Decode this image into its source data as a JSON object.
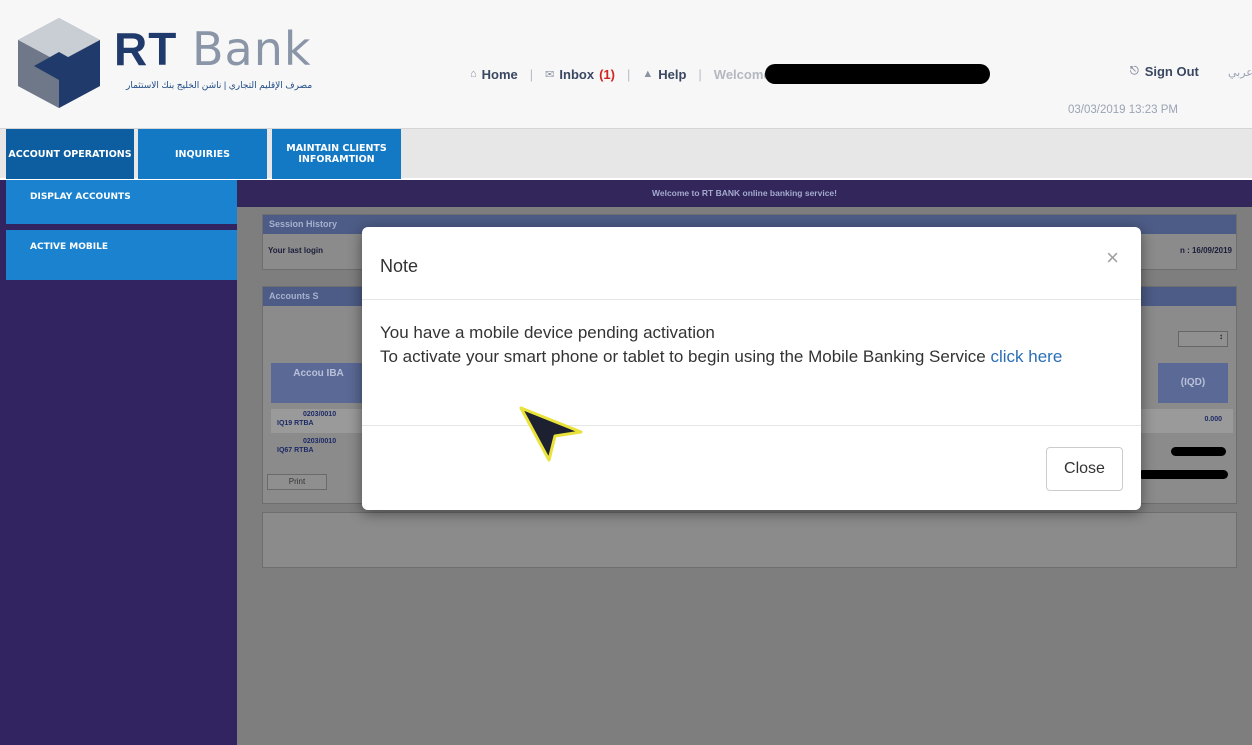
{
  "header": {
    "logo_rt": "RT",
    "logo_bank": "Bank",
    "logo_subtitle": "مصرف الإقليم التجاري | ناشن الخليج بنك الاستثمار",
    "nav": {
      "home": "Home",
      "inbox": "Inbox",
      "inbox_count": "(1)",
      "help": "Help",
      "welcome": "Welcome"
    },
    "sign_out": "Sign Out",
    "language": "عربي",
    "datetime": "03/03/2019 13:23 PM"
  },
  "tabs": [
    {
      "label": "ACCOUNT OPERATIONS"
    },
    {
      "label": "INQUIRIES"
    },
    {
      "label": "MAINTAIN CLIENTS INFORAMTION"
    }
  ],
  "sidebar": {
    "items": [
      {
        "label": "DISPLAY ACCOUNTS"
      },
      {
        "label": "ACTIVE MOBILE"
      }
    ]
  },
  "main": {
    "welcome_banner": "Welcome to RT BANK online banking service!",
    "session_history": {
      "title": "Session History",
      "last_login_label": "Your last login",
      "right_value": "n : 16/09/2019"
    },
    "accounts": {
      "title": "Accounts S",
      "col_account": "Accou IBA",
      "col_balance": "(IQD)",
      "select_value": "↕",
      "row1_a": "0203/0010",
      "row1_b": "IQ19 RTBA",
      "row1_value": "0.000",
      "row2_a": "0203/0010",
      "row2_b": "IQ67 RTBA",
      "print": "Print"
    }
  },
  "modal": {
    "title": "Note",
    "close_x": "×",
    "line1": "You have a mobile device pending activation",
    "line2": "To activate your smart phone or tablet to begin using the Mobile Banking Service",
    "link": "click here",
    "close_button": "Close"
  },
  "colors": {
    "tab_blue": "#1479c5",
    "sidebar_purple": "#312460",
    "link_blue": "#2a6fb5",
    "inbox_count_red": "#d0251f"
  }
}
